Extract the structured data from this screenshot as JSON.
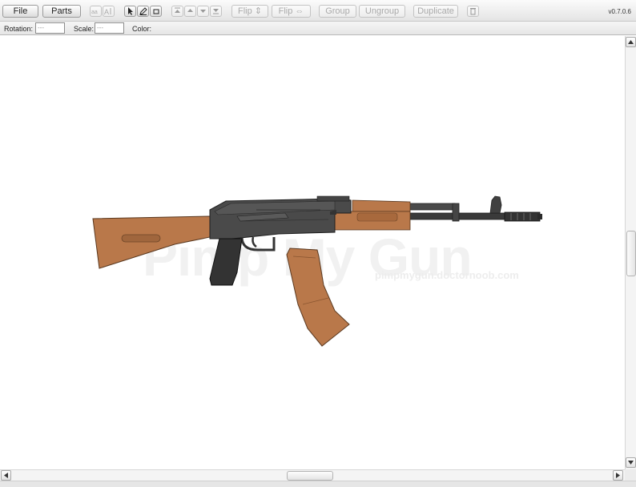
{
  "toolbar": {
    "file_label": "File",
    "parts_label": "Parts",
    "flip_vertical_label": "Flip ⇕",
    "flip_horizontal_label": "Flip ⇔",
    "group_label": "Group",
    "ungroup_label": "Ungroup",
    "duplicate_label": "Duplicate",
    "version": "v0.7.0.6",
    "icons": [
      "font-small-icon",
      "font-large-icon",
      "select-arrow-icon",
      "edit-icon",
      "crop-icon",
      "move-top-icon",
      "move-up-icon",
      "move-down-icon",
      "move-bottom-icon",
      "trash-icon"
    ]
  },
  "properties": {
    "rotation_label": "Rotation:",
    "rotation_value": "---",
    "scale_label": "Scale:",
    "scale_value": "---",
    "color_label": "Color:"
  },
  "canvas": {
    "watermark_title": "Pimp My Gun",
    "watermark_url": "pimpmygun.doctornoob.com"
  },
  "colors": {
    "wood": "#b9784a",
    "wood_dark": "#8f5a33",
    "metal": "#4a4a4a",
    "metal_dark": "#2e2e2e"
  }
}
